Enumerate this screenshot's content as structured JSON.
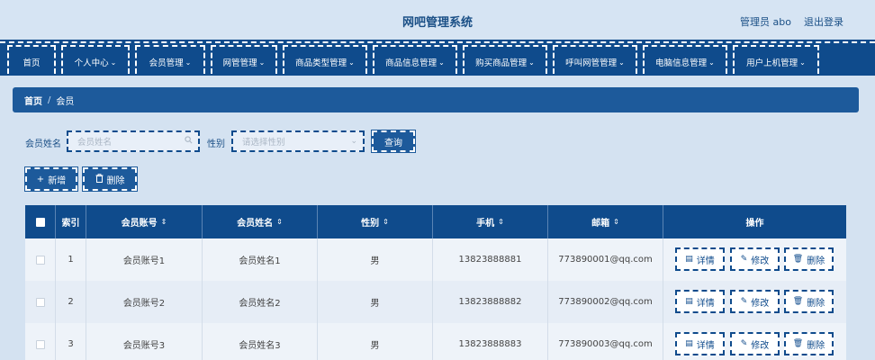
{
  "header": {
    "title": "网吧管理系统",
    "user": "管理员 abo",
    "logout": "退出登录"
  },
  "nav": {
    "items": [
      {
        "label": "首页",
        "chevron": false
      },
      {
        "label": "个人中心",
        "chevron": true
      },
      {
        "label": "会员管理",
        "chevron": true
      },
      {
        "label": "网管管理",
        "chevron": true
      },
      {
        "label": "商品类型管理",
        "chevron": true
      },
      {
        "label": "商品信息管理",
        "chevron": true
      },
      {
        "label": "购买商品管理",
        "chevron": true
      },
      {
        "label": "呼叫网管管理",
        "chevron": true
      },
      {
        "label": "电脑信息管理",
        "chevron": true
      },
      {
        "label": "用户上机管理",
        "chevron": true
      }
    ],
    "chevron_glyph": "⌄"
  },
  "breadcrumb": {
    "home": "首页",
    "separator": "/",
    "current": "会员"
  },
  "search": {
    "name_label": "会员姓名",
    "name_placeholder": "会员姓名",
    "gender_label": "性别",
    "gender_placeholder": "请选择性别",
    "query_button": "查询"
  },
  "actions": {
    "add": "新增",
    "add_icon": "+",
    "delete": "删除",
    "delete_icon": "🗑"
  },
  "table": {
    "headers": {
      "index": "索引",
      "account": "会员账号",
      "name": "会员姓名",
      "gender": "性别",
      "phone": "手机",
      "email": "邮箱",
      "ops": "操作"
    },
    "sort_glyph": "⇕",
    "rows": [
      {
        "index": "1",
        "account": "会员账号1",
        "name": "会员姓名1",
        "gender": "男",
        "phone": "13823888881",
        "email": "773890001@qq.com"
      },
      {
        "index": "2",
        "account": "会员账号2",
        "name": "会员姓名2",
        "gender": "男",
        "phone": "13823888882",
        "email": "773890002@qq.com"
      },
      {
        "index": "3",
        "account": "会员账号3",
        "name": "会员姓名3",
        "gender": "男",
        "phone": "13823888883",
        "email": "773890003@qq.com"
      }
    ],
    "row_actions": {
      "detail": "详情",
      "edit": "修改",
      "delete": "删除"
    }
  },
  "colors": {
    "primary": "#0f4b8c",
    "breadcrumb_bg": "#1d5a9b",
    "page_bg": "#d4e2f1"
  }
}
